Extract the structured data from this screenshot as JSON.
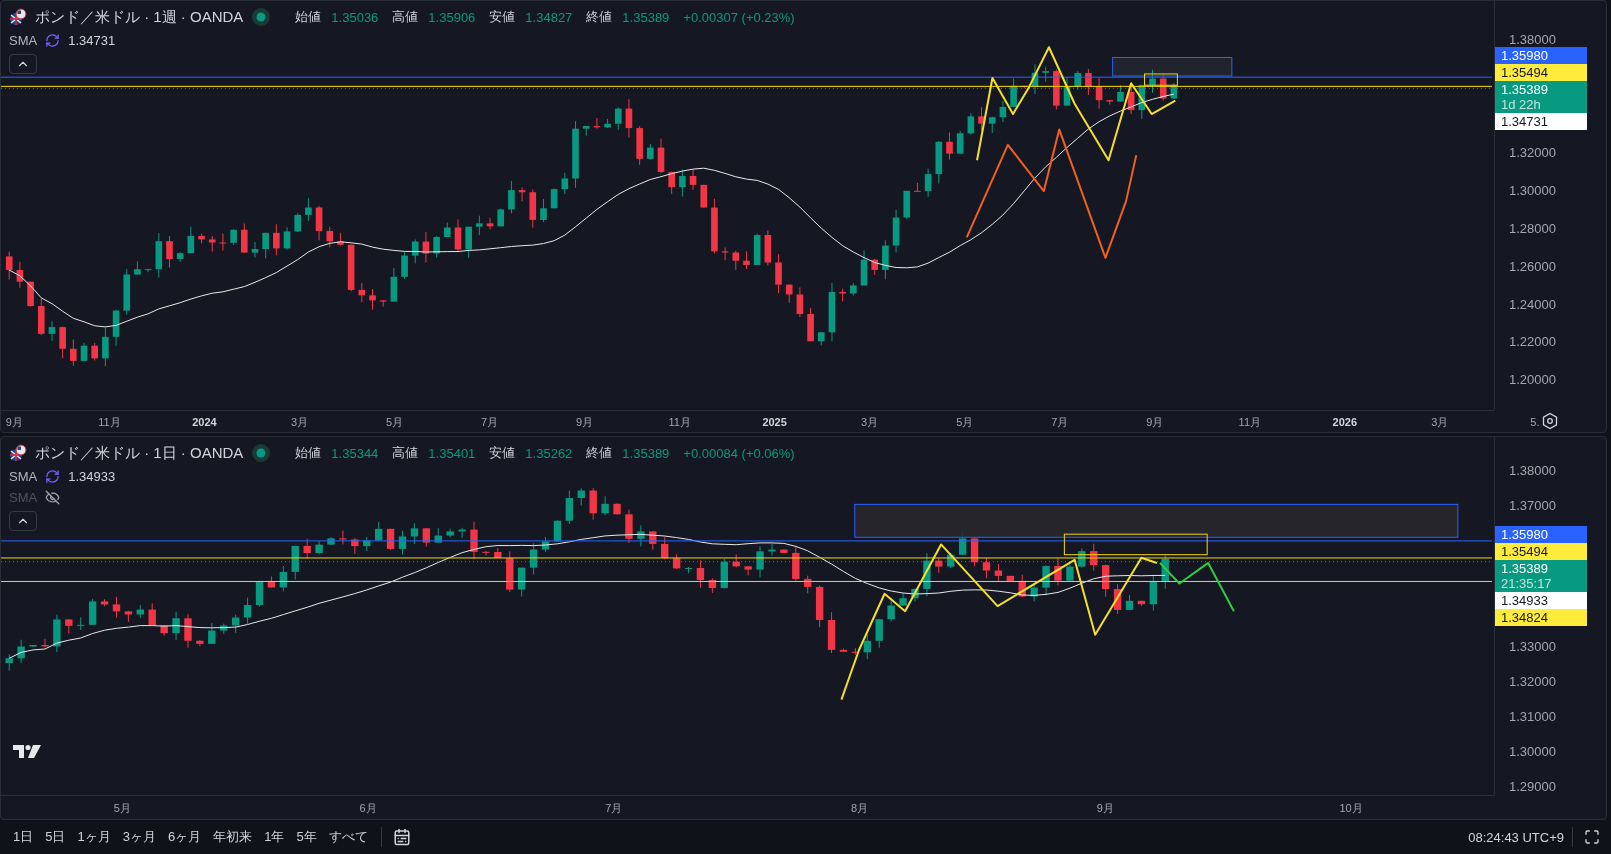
{
  "panes": [
    {
      "title": "ポンド／米ドル · 1週 · OANDA",
      "ohlc": [
        {
          "label": "始値",
          "value": "1.35036"
        },
        {
          "label": "高値",
          "value": "1.35906"
        },
        {
          "label": "安値",
          "value": "1.34827"
        },
        {
          "label": "終値",
          "value": "1.35389"
        }
      ],
      "change": "+0.00307 (+0.23%)",
      "indicators": [
        {
          "name": "SMA",
          "value": "1.34731",
          "visible": true
        }
      ],
      "price_ticks": [
        "1.38000",
        "1.32000",
        "1.30000",
        "1.28000",
        "1.26000",
        "1.24000",
        "1.22000",
        "1.20000"
      ],
      "price_tags": [
        {
          "value": "1.35980",
          "color": "#2962ff"
        },
        {
          "value": "1.35494",
          "color": "#ffeb3b"
        },
        {
          "value": "1.35389",
          "countdown": "1d 22h",
          "color": "#089981"
        },
        {
          "value": "1.34731",
          "color": "#ffffff"
        }
      ],
      "time_ticks": [
        {
          "label": "9月",
          "bold": false
        },
        {
          "label": "11月",
          "bold": false
        },
        {
          "label": "2024",
          "bold": true
        },
        {
          "label": "3月",
          "bold": false
        },
        {
          "label": "5月",
          "bold": false
        },
        {
          "label": "7月",
          "bold": false
        },
        {
          "label": "9月",
          "bold": false
        },
        {
          "label": "11月",
          "bold": false
        },
        {
          "label": "2025",
          "bold": true
        },
        {
          "label": "3月",
          "bold": false
        },
        {
          "label": "5月",
          "bold": false
        },
        {
          "label": "7月",
          "bold": false
        },
        {
          "label": "9月",
          "bold": false
        },
        {
          "label": "11月",
          "bold": false
        },
        {
          "label": "2026",
          "bold": true
        },
        {
          "label": "3月",
          "bold": false
        },
        {
          "label": "5.",
          "bold": false
        }
      ]
    },
    {
      "title": "ポンド／米ドル · 1日 · OANDA",
      "ohlc": [
        {
          "label": "始値",
          "value": "1.35344"
        },
        {
          "label": "高値",
          "value": "1.35401"
        },
        {
          "label": "安値",
          "value": "1.35262"
        },
        {
          "label": "終値",
          "value": "1.35389"
        }
      ],
      "change": "+0.00084 (+0.06%)",
      "indicators": [
        {
          "name": "SMA",
          "value": "1.34933",
          "visible": true
        },
        {
          "name": "SMA",
          "visible": false
        }
      ],
      "price_ticks": [
        "1.38000",
        "1.37000",
        "1.33000",
        "1.32000",
        "1.31000",
        "1.30000",
        "1.29000"
      ],
      "price_tags": [
        {
          "value": "1.35980",
          "color": "#2962ff"
        },
        {
          "value": "1.35494",
          "color": "#ffeb3b"
        },
        {
          "value": "1.35389",
          "countdown": "21:35:17",
          "color": "#089981"
        },
        {
          "value": "1.34933",
          "color": "#ffffff"
        },
        {
          "value": "1.34824",
          "color": "#ffeb3b"
        }
      ],
      "time_ticks": [
        {
          "label": "5月",
          "bold": false
        },
        {
          "label": "6月",
          "bold": false
        },
        {
          "label": "7月",
          "bold": false
        },
        {
          "label": "8月",
          "bold": false
        },
        {
          "label": "9月",
          "bold": false
        },
        {
          "label": "10月",
          "bold": false
        }
      ]
    }
  ],
  "toolbar": {
    "ranges": [
      "1日",
      "5日",
      "1ヶ月",
      "3ヶ月",
      "6ヶ月",
      "年初来",
      "1年",
      "5年",
      "すべて"
    ],
    "clock": "08:24:43 UTC+9"
  }
}
